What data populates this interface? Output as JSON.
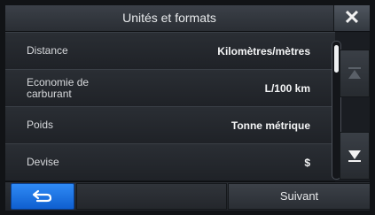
{
  "header": {
    "title": "Unités et formats",
    "close_icon": "close-icon"
  },
  "settings": [
    {
      "label": "Distance",
      "value": "Kilomètres/mètres"
    },
    {
      "label": "Economie de carburant",
      "value": "L/100 km"
    },
    {
      "label": "Poids",
      "value": "Tonne métrique"
    },
    {
      "label": "Devise",
      "value": "$"
    }
  ],
  "sidebar": {
    "scroll_up_icon": "scroll-top-icon",
    "scroll_down_icon": "scroll-bottom-icon"
  },
  "footer": {
    "back_icon": "back-arrow-icon",
    "next_label": "Suivant"
  },
  "colors": {
    "accent": "#1e73e8",
    "background": "#1a1d22",
    "text": "#e8eaec"
  }
}
